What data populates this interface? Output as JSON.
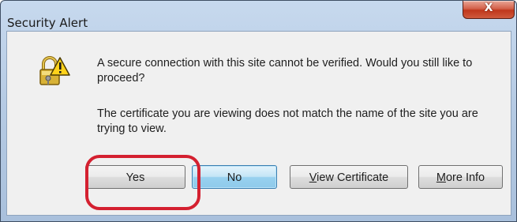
{
  "window": {
    "title": "Security Alert",
    "close_label": "X"
  },
  "dialog": {
    "icon": "lock-warning-icon",
    "message_line1": "A secure connection with this site cannot be verified. Would you still like to proceed?",
    "message_line2": "The certificate you are viewing does not match the name of the site you are trying to view."
  },
  "buttons": {
    "yes": "Yes",
    "no": "No",
    "view_certificate_first": "V",
    "view_certificate_rest": "iew Certificate",
    "more_info_first": "M",
    "more_info_rest": "ore Info"
  },
  "colors": {
    "annotation_circle": "#d42030",
    "title_gradient": "#b6cbe4",
    "close_button": "#c0371c"
  }
}
